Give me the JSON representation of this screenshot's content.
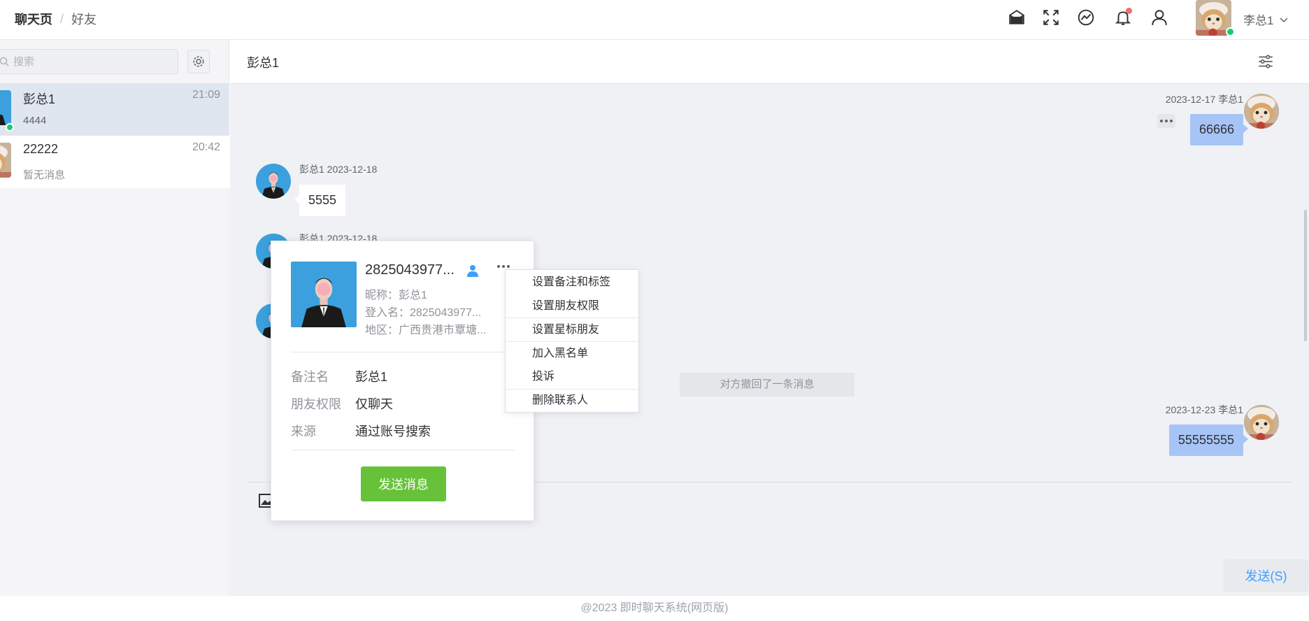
{
  "header": {
    "breadcrumb": [
      "聊天页",
      "好友"
    ],
    "separator": "/",
    "username": "李总1",
    "icons": [
      "mail-icon",
      "fullscreen-icon",
      "chart-icon",
      "bell-icon",
      "user-icon",
      "chevron-down-icon"
    ],
    "notification_dot_color": "#f56c6c",
    "online_color": "#13ce66"
  },
  "sidebar": {
    "search_placeholder": "搜索",
    "conversations": [
      {
        "name": "彭总1",
        "time": "21:09",
        "last_message": "4444",
        "active": true,
        "online": true
      },
      {
        "name": "22222",
        "time": "20:42",
        "last_message": "暂无消息",
        "active": false,
        "online": false
      }
    ]
  },
  "chat": {
    "title": "彭总1",
    "messages": [
      {
        "side": "me",
        "meta": "2023-12-17 李总1",
        "text": "66666"
      },
      {
        "side": "other",
        "meta": "彭总1 2023-12-18",
        "text": "5555"
      },
      {
        "side": "other",
        "meta": "彭总1 2023-12-18",
        "text": ""
      },
      {
        "side": "system",
        "text": "对方撤回了一条消息"
      },
      {
        "side": "me",
        "meta": "2023-12-23 李总1",
        "text": "55555555"
      }
    ],
    "send_label": "发送(S)",
    "bubble_color_me": "#a7c4f7",
    "accent": "#409eff"
  },
  "profile": {
    "display_name": "2825043977...",
    "nickname": "昵称：彭总1",
    "login_name": "登入名：2825043977...",
    "region": "地区：广西贵港市覃塘...",
    "fields": [
      {
        "label": "备注名",
        "value": "彭总1"
      },
      {
        "label": "朋友权限",
        "value": "仅聊天"
      },
      {
        "label": "来源",
        "value": "通过账号搜索"
      }
    ],
    "send_message": "发送消息",
    "button_color": "#67c23a"
  },
  "context_menu": {
    "items": [
      "设置备注和标签",
      "设置朋友权限",
      "设置星标朋友",
      "加入黑名单",
      "投诉",
      "删除联系人"
    ]
  },
  "footer": "@2023 即时聊天系统(网页版)"
}
